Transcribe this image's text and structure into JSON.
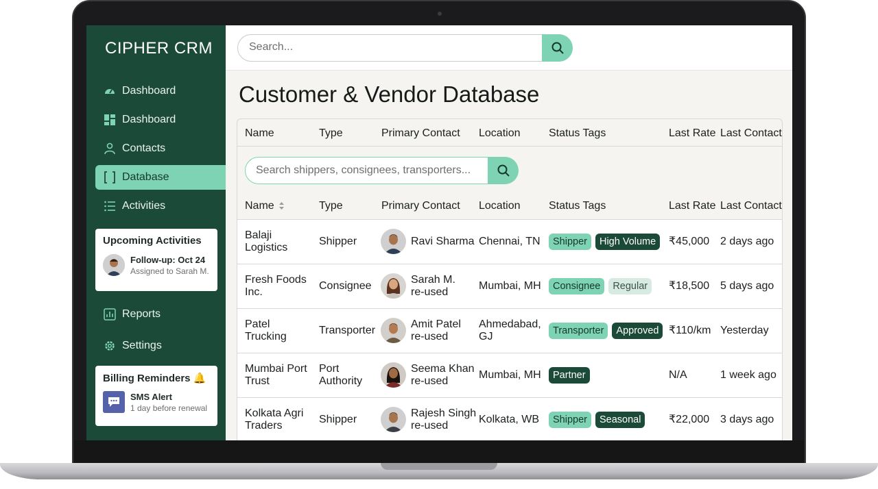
{
  "app": {
    "title": "CIPHER CRM"
  },
  "sidebar": {
    "items": [
      {
        "label": "Dashboard",
        "icon": "gauge-icon"
      },
      {
        "label": "Dashboard",
        "icon": "grid-icon"
      },
      {
        "label": "Contacts",
        "icon": "person-icon"
      },
      {
        "label": "Database",
        "icon": "bracket-icon",
        "active": true
      },
      {
        "label": "Activities",
        "icon": "list-icon"
      },
      {
        "label": "Reports",
        "icon": "chart-icon"
      },
      {
        "label": "Settings",
        "icon": "gear-icon"
      }
    ],
    "upcoming": {
      "title": "Upcoming Activities",
      "line1": "Follow-up: Oct 24",
      "line2": "Assigned to Sarah M."
    },
    "billing": {
      "title": "Billing Reminders 🔔",
      "line1": "SMS Alert",
      "line2": "1 day before renewal"
    }
  },
  "search": {
    "placeholder": "Search..."
  },
  "page": {
    "title": "Customer & Vendor Database"
  },
  "table": {
    "columns": [
      "Name",
      "Type",
      "Primary Contact",
      "Location",
      "Status Tags",
      "Last Rate",
      "Last Contact"
    ],
    "search_placeholder": "Search shippers, consignees, transporters...",
    "rows": [
      {
        "name": [
          "Balaji",
          "Logistics"
        ],
        "type": [
          "Shipper"
        ],
        "contact": [
          "Ravi Sharma"
        ],
        "location": [
          "Chennai, TN"
        ],
        "tags": [
          {
            "text": "Shipper",
            "style": "light"
          },
          {
            "text": "High Volume",
            "style": "dark"
          }
        ],
        "rate": "₹45,000",
        "last": "2 days ago"
      },
      {
        "name": [
          "Fresh Foods",
          "Inc."
        ],
        "type": [
          "Consignee"
        ],
        "contact": [
          "Sarah M.",
          "re-used"
        ],
        "location": [
          "Mumbai, MH"
        ],
        "tags": [
          {
            "text": "Consignee",
            "style": "light"
          },
          {
            "text": "Regular",
            "style": "pale"
          }
        ],
        "rate": "₹18,500",
        "last": "5 days ago"
      },
      {
        "name": [
          "Patel",
          "Trucking"
        ],
        "type": [
          "Transporter"
        ],
        "contact": [
          "Amit Patel",
          "re-used"
        ],
        "location": [
          "Ahmedabad,",
          "GJ"
        ],
        "tags": [
          {
            "text": "Transporter",
            "style": "light"
          },
          {
            "text": "Approved",
            "style": "dark"
          }
        ],
        "rate": "₹110/km",
        "last": "Yesterday"
      },
      {
        "name": [
          "Mumbai Port",
          "Trust"
        ],
        "type": [
          "Port",
          "Authority"
        ],
        "contact": [
          "Seema Khan",
          "re-used"
        ],
        "location": [
          "Mumbai, MH"
        ],
        "tags": [
          {
            "text": "Partner",
            "style": "dark"
          }
        ],
        "rate": "N/A",
        "last": "1 week ago"
      },
      {
        "name": [
          "Kolkata Agri",
          "Traders"
        ],
        "type": [
          "Shipper"
        ],
        "contact": [
          "Rajesh Singh",
          "re-used"
        ],
        "location": [
          "Kolkata, WB"
        ],
        "tags": [
          {
            "text": "Shipper",
            "style": "light"
          },
          {
            "text": "Seasonal",
            "style": "dark"
          }
        ],
        "rate": "₹22,000",
        "last": "3 days ago"
      }
    ]
  },
  "colors": {
    "sidebar": "#1c4a39",
    "accent": "#7fd3b5",
    "tag_dark": "#1c4a39"
  }
}
